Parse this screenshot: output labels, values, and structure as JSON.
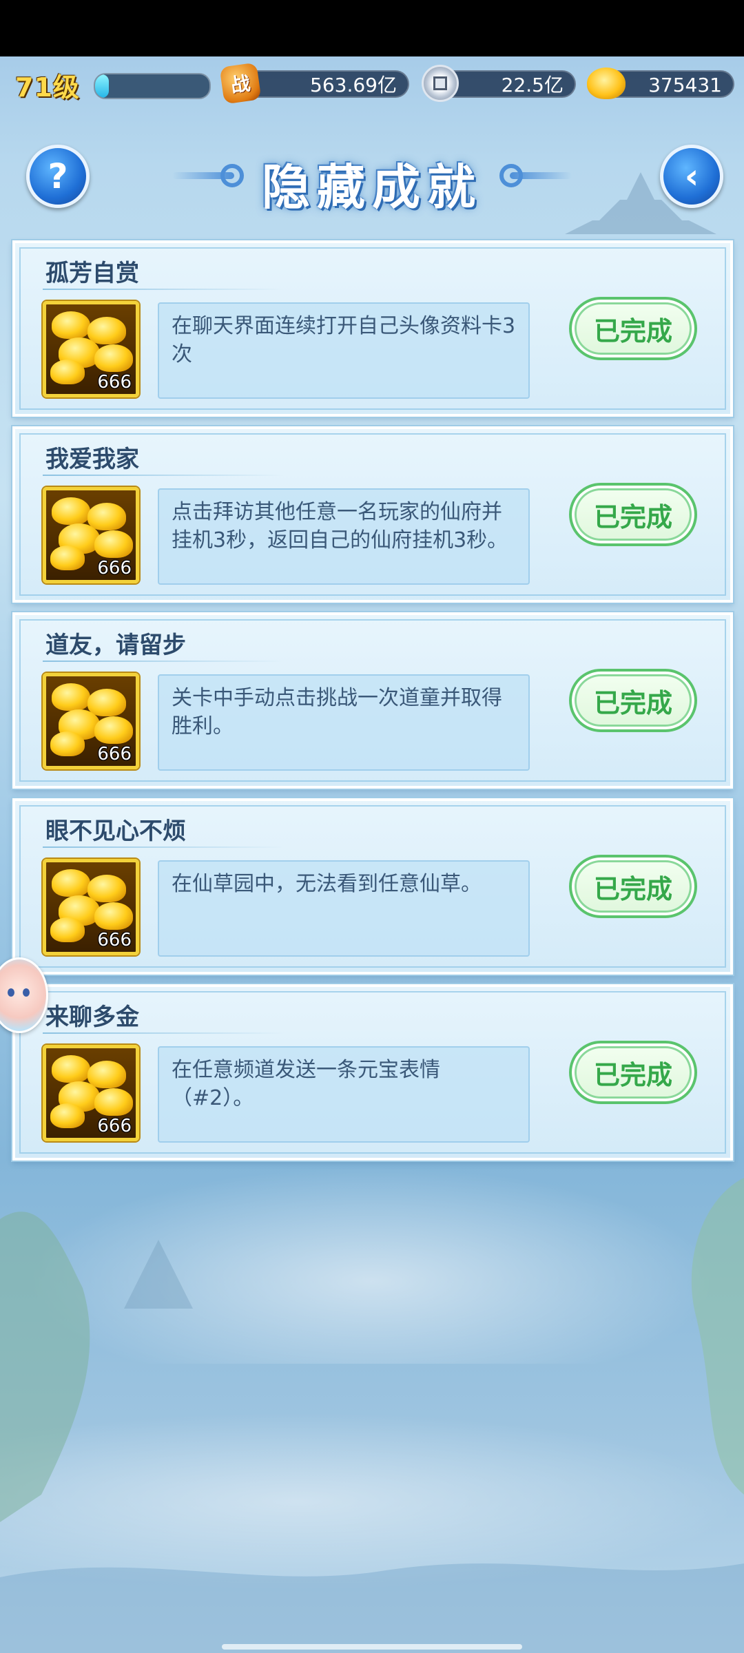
{
  "topbar": {
    "level": "71级",
    "xp_fraction": 0.12,
    "power": "563.69亿",
    "coins": "22.5亿",
    "gold": "375431",
    "power_icon_glyph": "战"
  },
  "header": {
    "title": "隐藏成就",
    "help_glyph": "?",
    "back_glyph": "‹"
  },
  "achievements": [
    {
      "title": "孤芳自赏",
      "desc": "在聊天界面连续打开自己头像资料卡3次",
      "reward": "666",
      "status": "已完成"
    },
    {
      "title": "我爱我家",
      "desc": "点击拜访其他任意一名玩家的仙府并挂机3秒，返回自己的仙府挂机3秒。",
      "reward": "666",
      "status": "已完成"
    },
    {
      "title": "道友，请留步",
      "desc": "关卡中手动点击挑战一次道童并取得胜利。",
      "reward": "666",
      "status": "已完成"
    },
    {
      "title": "眼不见心不烦",
      "desc": "在仙草园中，无法看到任意仙草。",
      "reward": "666",
      "status": "已完成"
    },
    {
      "title": "来聊多金",
      "desc": "在任意频道发送一条元宝表情（#2）。",
      "reward": "666",
      "status": "已完成"
    }
  ],
  "colors": {
    "done_green": "#35a84a",
    "title_blue": "#2d4b6c",
    "level_gold": "#ffd94a"
  }
}
